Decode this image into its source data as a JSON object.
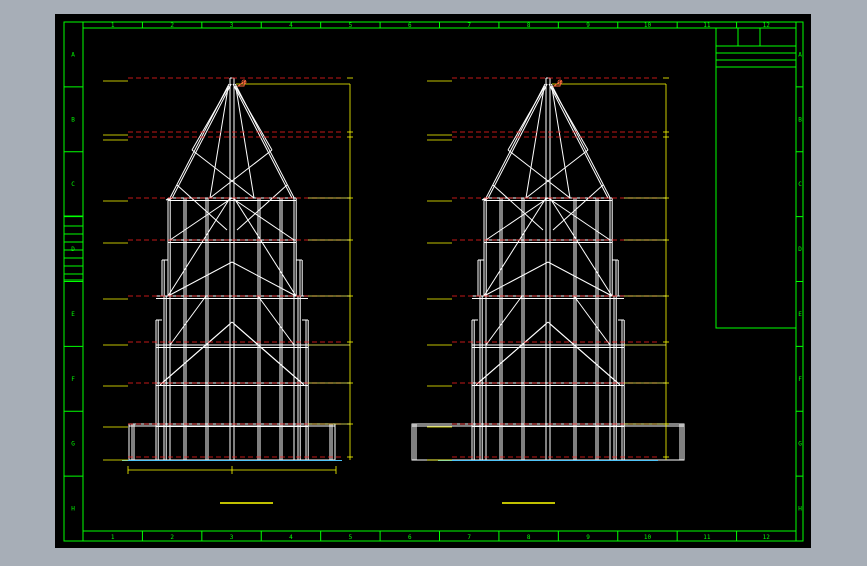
{
  "colors": {
    "background": "#a7aeb7",
    "sheet": "#000000",
    "frame": "#00ff00",
    "structure": "#ffffff",
    "level_text": "#ffff00",
    "level_line": "#ff2020",
    "dimension": "#ff6a3d",
    "guide": "#ffff60"
  },
  "grid": {
    "columns": [
      "1",
      "2",
      "3",
      "4",
      "5",
      "6",
      "7",
      "8",
      "9",
      "10",
      "11",
      "12"
    ],
    "rows": [
      "A",
      "B",
      "C",
      "D",
      "E",
      "F",
      "G",
      "H"
    ]
  },
  "title_block": {
    "header": "",
    "row2": ""
  },
  "elevations": [
    {
      "id": "left",
      "caption": "",
      "levels": [
        "",
        "",
        "",
        "",
        "",
        "",
        "",
        "",
        "",
        ""
      ]
    },
    {
      "id": "right",
      "caption": "",
      "levels": [
        "",
        "",
        "",
        "",
        "",
        "",
        "",
        "",
        "",
        ""
      ]
    }
  ]
}
